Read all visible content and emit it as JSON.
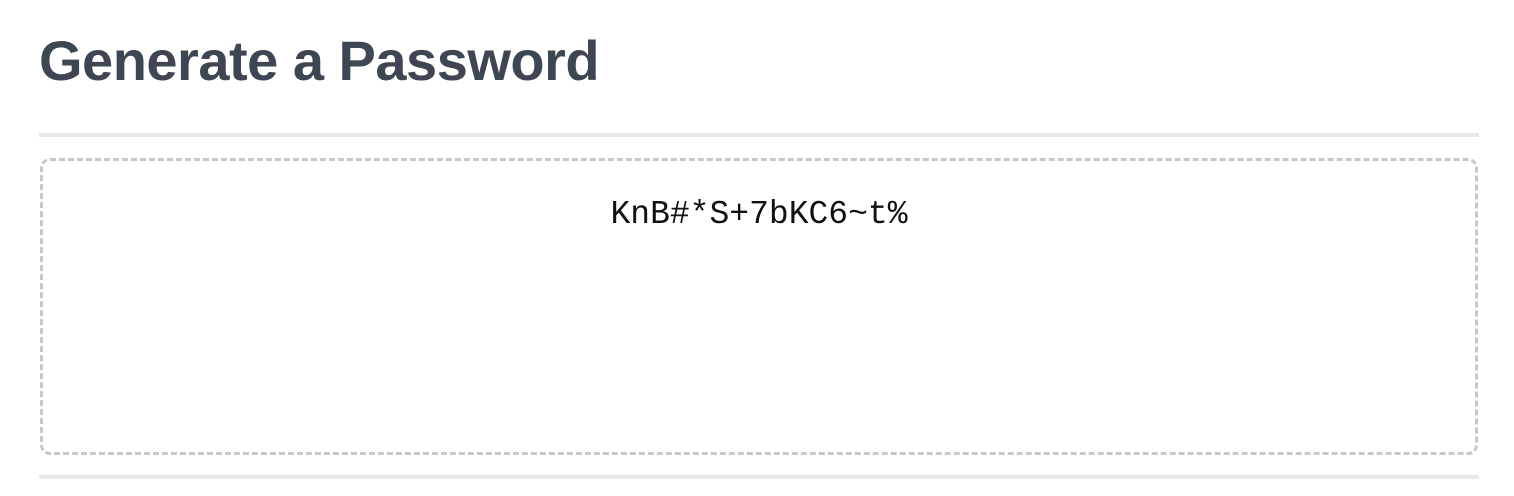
{
  "header": {
    "title": "Generate a Password"
  },
  "password_box": {
    "value": "KnB#*S+7bKC6~t%",
    "placeholder": ""
  }
}
